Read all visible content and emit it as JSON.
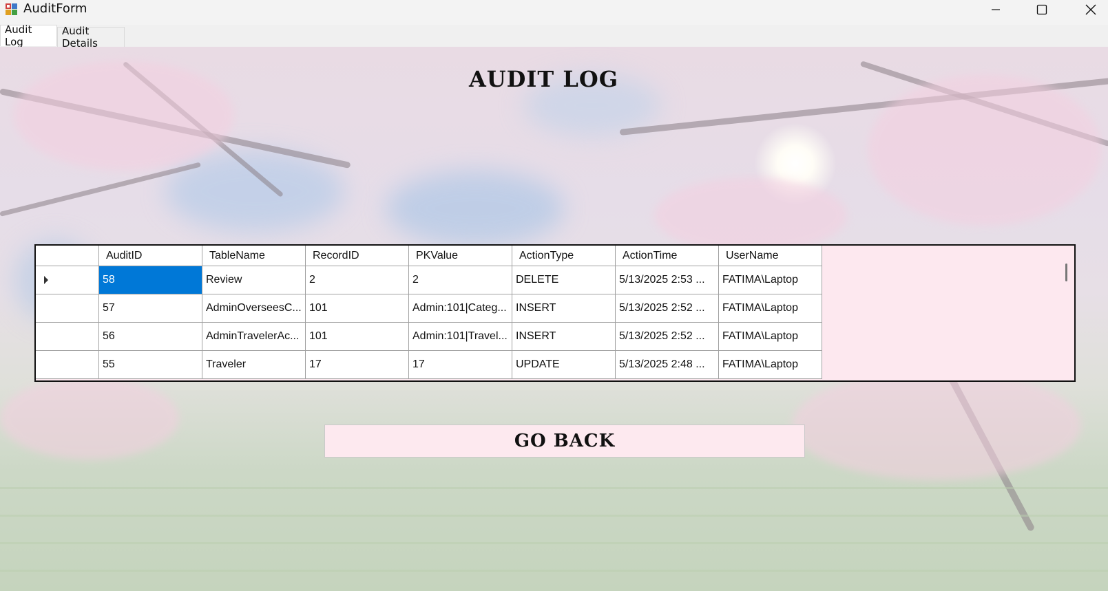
{
  "window": {
    "title": "AuditForm",
    "minimize_icon": "minimize-icon",
    "maximize_icon": "maximize-icon",
    "close_icon": "close-icon"
  },
  "tabs": [
    {
      "label": "Audit Log",
      "active": true
    },
    {
      "label": "Audit Details",
      "active": false
    }
  ],
  "heading": "AUDIT LOG",
  "grid": {
    "columns": [
      "AuditID",
      "TableName",
      "RecordID",
      "PKValue",
      "ActionType",
      "ActionTime",
      "UserName"
    ],
    "rows": [
      {
        "AuditID": "58",
        "TableName": "Review",
        "RecordID": "2",
        "PKValue": "2",
        "ActionType": "DELETE",
        "ActionTime": "5/13/2025 2:53 ...",
        "UserName": "FATIMA\\Laptop",
        "current": true
      },
      {
        "AuditID": "57",
        "TableName": "AdminOverseesC...",
        "RecordID": "101",
        "PKValue": "Admin:101|Categ...",
        "ActionType": "INSERT",
        "ActionTime": "5/13/2025 2:52 ...",
        "UserName": "FATIMA\\Laptop"
      },
      {
        "AuditID": "56",
        "TableName": "AdminTravelerAc...",
        "RecordID": "101",
        "PKValue": "Admin:101|Travel...",
        "ActionType": "INSERT",
        "ActionTime": "5/13/2025 2:52 ...",
        "UserName": "FATIMA\\Laptop"
      },
      {
        "AuditID": "55",
        "TableName": "Traveler",
        "RecordID": "17",
        "PKValue": "17",
        "ActionType": "UPDATE",
        "ActionTime": "5/13/2025 2:48 ...",
        "UserName": "FATIMA\\Laptop"
      }
    ],
    "current_row_icon": "row-pointer-icon",
    "selection_color": "#0078d7",
    "grid_background": "#fde8ef"
  },
  "go_back_label": "GO BACK",
  "colors": {
    "button_background": "#fde9ef"
  }
}
